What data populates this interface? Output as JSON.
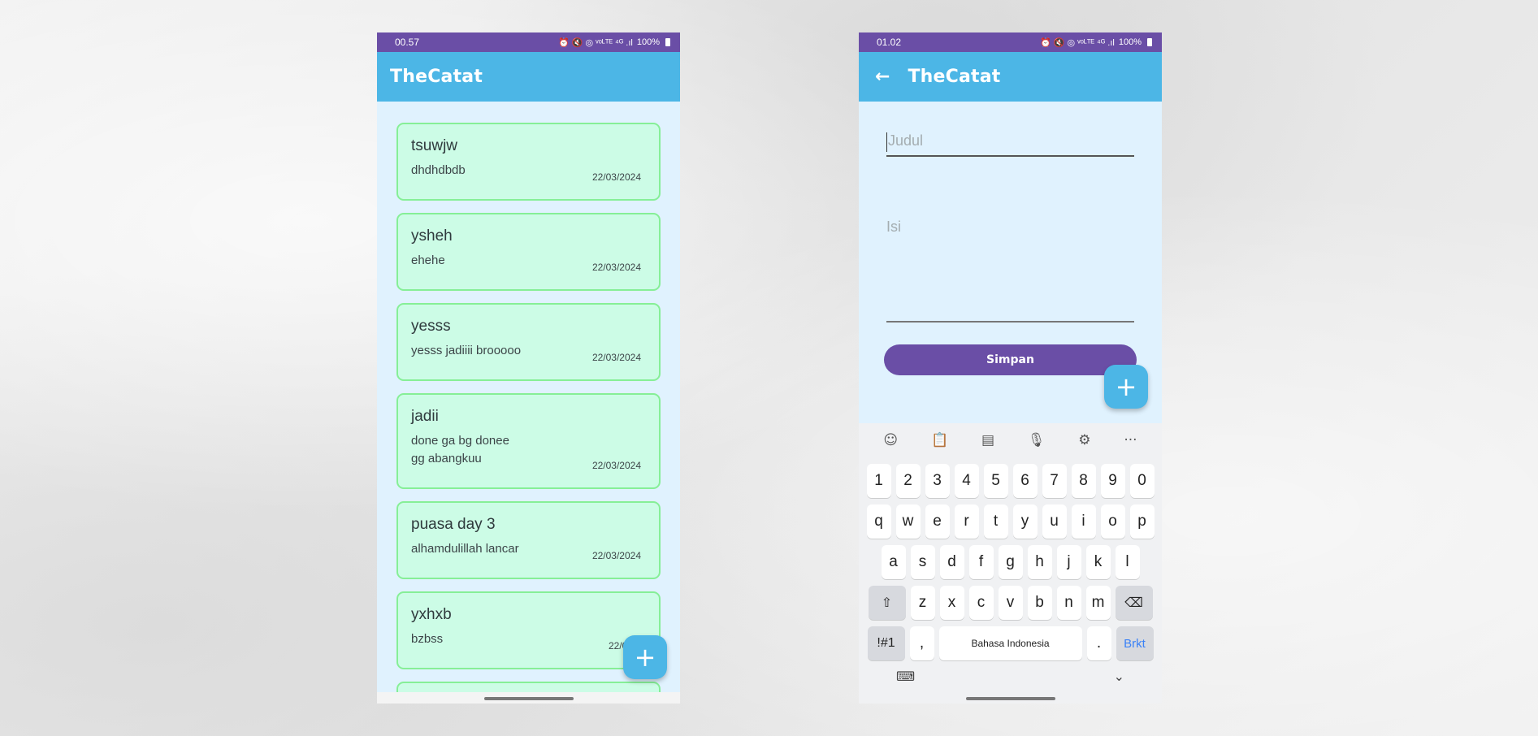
{
  "left_phone": {
    "status_time": "00.57",
    "status_icons": "⏰ 🔇 ◎ ᵛᵒᴸᵀᴱ ⁴ᴳ .ıl",
    "battery": "100%",
    "app_title": "TheCatat",
    "notes": [
      {
        "title": "tsuwjw",
        "body": "dhdhdbdb",
        "date": "22/03/2024"
      },
      {
        "title": "ysheh",
        "body": "ehehe",
        "date": "22/03/2024"
      },
      {
        "title": "yesss",
        "body": "yesss jadiiii brooooo",
        "date": "22/03/2024"
      },
      {
        "title": "jadii",
        "body": "done ga bg donee\ngg abangkuu",
        "date": "22/03/2024"
      },
      {
        "title": "puasa day 3",
        "body": "alhamdulillah lancar",
        "date": "22/03/2024"
      },
      {
        "title": "yxhxb",
        "body": "bzbss",
        "date": "22/03/2"
      }
    ],
    "fab_symbol": "+"
  },
  "right_phone": {
    "status_time": "01.02",
    "status_icons": "⏰ 🔇 ◎ ᵛᵒᴸᵀᴱ ⁴ᴳ .ıl",
    "battery": "100%",
    "back_symbol": "←",
    "app_title": "TheCatat",
    "title_placeholder": "Judul",
    "body_placeholder": "Isi",
    "save_label": "Simpan",
    "fab_symbol": "+",
    "keyboard": {
      "toolbar": [
        "☺",
        "📋",
        "▤",
        "🎙",
        "⚙",
        "···"
      ],
      "row_numbers": [
        "1",
        "2",
        "3",
        "4",
        "5",
        "6",
        "7",
        "8",
        "9",
        "0"
      ],
      "row_1": [
        "q",
        "w",
        "e",
        "r",
        "t",
        "y",
        "u",
        "i",
        "o",
        "p"
      ],
      "row_2": [
        "a",
        "s",
        "d",
        "f",
        "g",
        "h",
        "j",
        "k",
        "l"
      ],
      "row_3": [
        "z",
        "x",
        "c",
        "v",
        "b",
        "n",
        "m"
      ],
      "shift": "⇧",
      "backspace": "⌫",
      "symbols": "!#1",
      "comma": ",",
      "space": "Bahasa Indonesia",
      "period": ".",
      "enter": "Brkt",
      "bottom_left": "⌨",
      "bottom_right": "⌄"
    }
  }
}
